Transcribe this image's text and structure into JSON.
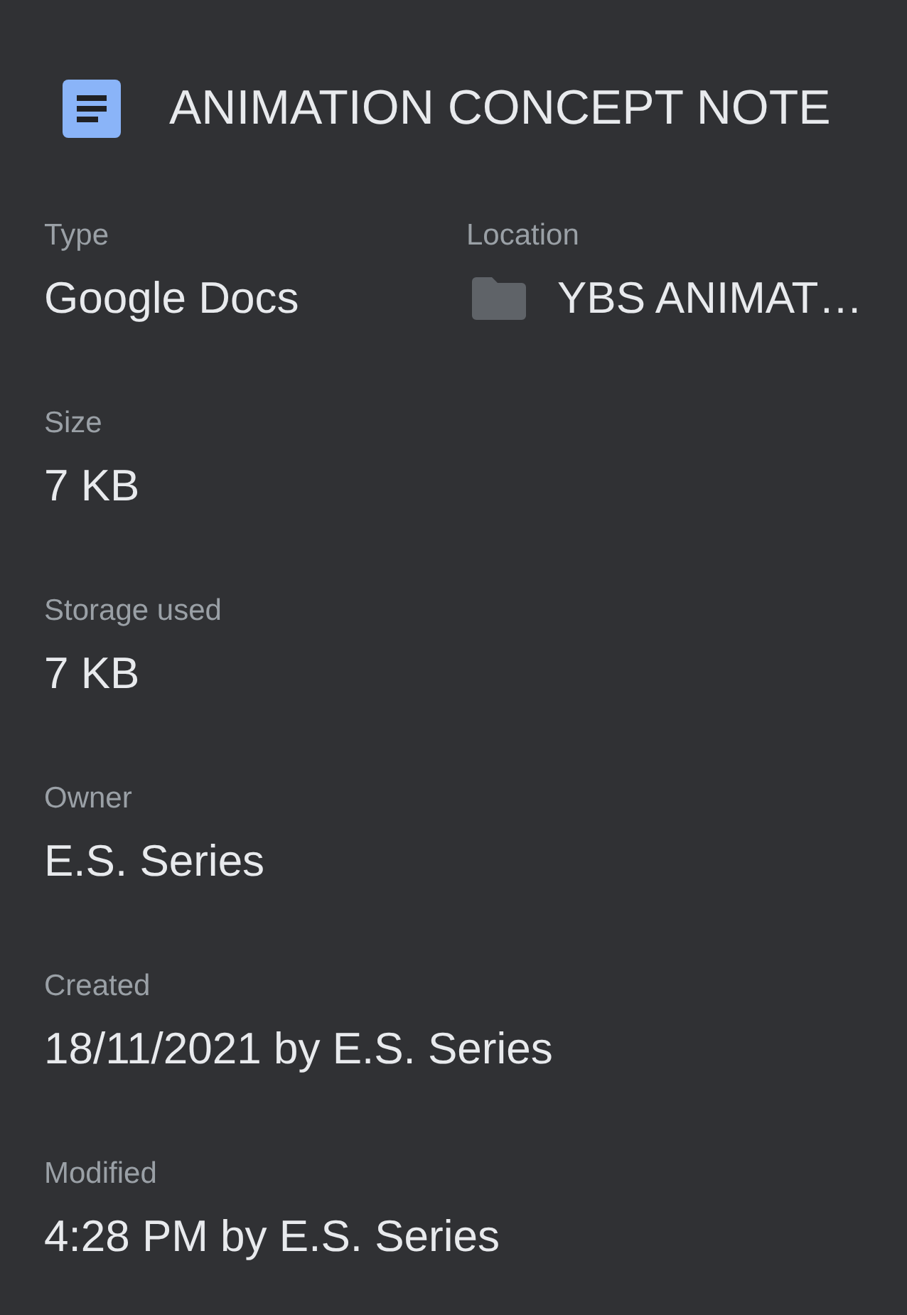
{
  "header": {
    "title": "ANIMATION CONCEPT NOTE"
  },
  "rows": [
    {
      "fields": [
        {
          "kind": "text",
          "label": "Type",
          "value": "Google Docs"
        },
        {
          "kind": "folder",
          "label": "Location",
          "value": "YBS ANIMAT…"
        }
      ]
    },
    {
      "fields": [
        {
          "kind": "text",
          "label": "Size",
          "value": "7 KB"
        }
      ]
    },
    {
      "fields": [
        {
          "kind": "text",
          "label": "Storage used",
          "value": "7 KB"
        }
      ]
    },
    {
      "fields": [
        {
          "kind": "text",
          "label": "Owner",
          "value": "E.S. Series"
        }
      ]
    },
    {
      "fields": [
        {
          "kind": "text",
          "label": "Created",
          "value": "18/11/2021 by E.S. Series"
        }
      ]
    },
    {
      "fields": [
        {
          "kind": "text",
          "label": "Modified",
          "value": "4:28 PM by E.S. Series"
        }
      ]
    }
  ]
}
